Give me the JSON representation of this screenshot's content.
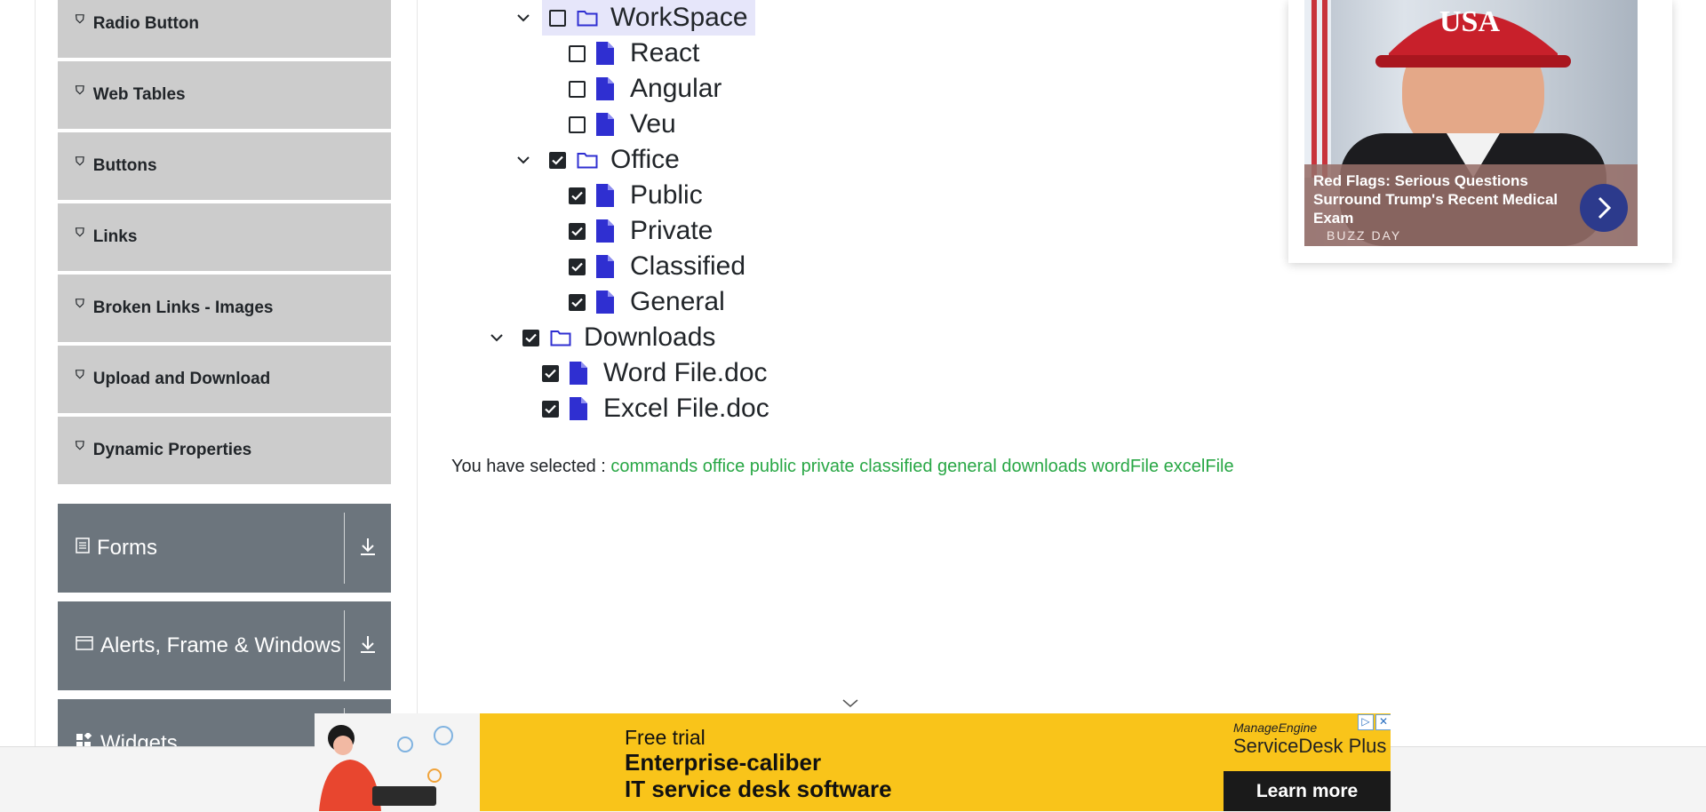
{
  "sidebar": {
    "items": [
      {
        "label": "Radio Button"
      },
      {
        "label": "Web Tables"
      },
      {
        "label": "Buttons"
      },
      {
        "label": "Links"
      },
      {
        "label": "Broken Links - Images"
      },
      {
        "label": "Upload and Download"
      },
      {
        "label": "Dynamic Properties"
      }
    ],
    "groups": [
      {
        "label": "Forms",
        "icon": "form-icon"
      },
      {
        "label": "Alerts, Frame & Windows",
        "icon": "window-icon"
      },
      {
        "label": "Widgets",
        "icon": "widgets-icon"
      }
    ]
  },
  "tree": {
    "nodes": [
      {
        "label": "WorkSpace",
        "type": "folder",
        "checked": false,
        "expanded": true,
        "highlighted": true
      },
      {
        "label": "React",
        "type": "file",
        "checked": false
      },
      {
        "label": "Angular",
        "type": "file",
        "checked": false
      },
      {
        "label": "Veu",
        "type": "file",
        "checked": false
      },
      {
        "label": "Office",
        "type": "folder",
        "checked": true,
        "expanded": true
      },
      {
        "label": "Public",
        "type": "file",
        "checked": true
      },
      {
        "label": "Private",
        "type": "file",
        "checked": true
      },
      {
        "label": "Classified",
        "type": "file",
        "checked": true
      },
      {
        "label": "General",
        "type": "file",
        "checked": true
      },
      {
        "label": "Downloads",
        "type": "folder",
        "checked": true,
        "expanded": true
      },
      {
        "label": "Word File.doc",
        "type": "file",
        "checked": true
      },
      {
        "label": "Excel File.doc",
        "type": "file",
        "checked": true
      }
    ]
  },
  "result": {
    "prefix": "You have selected :",
    "items": [
      "commands",
      "office",
      "public",
      "private",
      "classified",
      "general",
      "downloads",
      "wordFile",
      "excelFile"
    ]
  },
  "ad_card": {
    "cap_text": "USA",
    "title": "Red Flags: Serious Questions Surround Trump's Recent Medical Exam",
    "source": "BUZZ DAY"
  },
  "bottom_ad": {
    "free_trial": "Free trial",
    "headline1": "Enterprise-caliber",
    "headline2": "IT service desk software",
    "brand_small": "ManageEngine",
    "brand_product": "ServiceDesk Plus",
    "cta": "Learn more"
  },
  "colors": {
    "accent": "#2f2fd1",
    "success": "#28a745",
    "sidebar_item_bg": "#cccccc",
    "group_bg": "#6c757d",
    "ad_bg": "#f9c41a",
    "highlight": "#e6e6fa"
  }
}
